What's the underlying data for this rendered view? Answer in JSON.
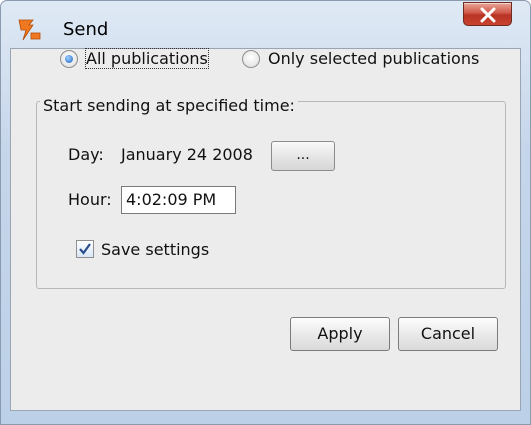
{
  "window": {
    "title": "Send",
    "app_icon": "flag-icon",
    "close_icon": "close-icon"
  },
  "publication_scope": {
    "options": [
      {
        "label": "All publications",
        "selected": true
      },
      {
        "label": "Only selected publications",
        "selected": false
      }
    ]
  },
  "schedule": {
    "group_label": "Start sending at specified time:",
    "day_label": "Day:",
    "day_value": "January 24 2008",
    "date_picker_label": "...",
    "hour_label": "Hour:",
    "hour_value": "4:02:09 PM",
    "save_settings_label": "Save settings",
    "save_settings_checked": true
  },
  "buttons": {
    "apply_label": "Apply",
    "cancel_label": "Cancel"
  },
  "colors": {
    "title_bar": "#c6d6ea",
    "close_button": "#c9442f",
    "radio_selected": "#1d63c4",
    "app_icon": "#f07820"
  }
}
